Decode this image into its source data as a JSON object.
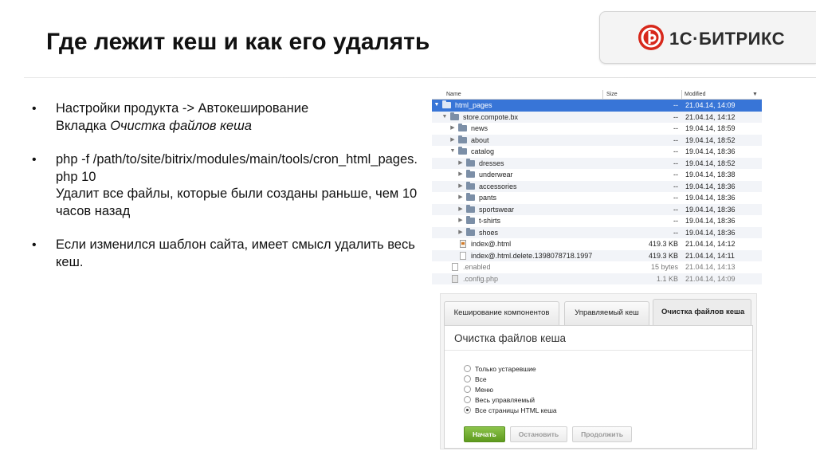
{
  "slide": {
    "title": "Где лежит кеш и как его удалять"
  },
  "logo": {
    "text": "1С·БИТРИКС",
    "mark_color": "#d7281b"
  },
  "bullets": [
    {
      "line1": "Настройки продукта -> Автокеширование",
      "line2_prefix": "Вкладка ",
      "line2_em": "Очистка файлов кеша"
    },
    {
      "cmd": "php -f /path/to/site/bitrix/modules/main/tools/cron_html_pages.php 10",
      "desc": "Удалит все файлы, которые были созданы раньше, чем 10 часов назад"
    },
    {
      "text": "Если изменился шаблон сайта, имеет смысл удалить весь кеш."
    }
  ],
  "file_browser": {
    "columns": {
      "name": "Name",
      "size": "Size",
      "modified": "Modified",
      "sort_indicator": "▼"
    },
    "rows": [
      {
        "name": "html_pages",
        "size": "--",
        "modified": "21.04.14, 14:09"
      },
      {
        "name": "store.compote.bx",
        "size": "--",
        "modified": "21.04.14, 14:12"
      },
      {
        "name": "news",
        "size": "--",
        "modified": "19.04.14, 18:59"
      },
      {
        "name": "about",
        "size": "--",
        "modified": "19.04.14, 18:52"
      },
      {
        "name": "catalog",
        "size": "--",
        "modified": "19.04.14, 18:36"
      },
      {
        "name": "dresses",
        "size": "--",
        "modified": "19.04.14, 18:52"
      },
      {
        "name": "underwear",
        "size": "--",
        "modified": "19.04.14, 18:38"
      },
      {
        "name": "accessories",
        "size": "--",
        "modified": "19.04.14, 18:36"
      },
      {
        "name": "pants",
        "size": "--",
        "modified": "19.04.14, 18:36"
      },
      {
        "name": "sportswear",
        "size": "--",
        "modified": "19.04.14, 18:36"
      },
      {
        "name": "t-shirts",
        "size": "--",
        "modified": "19.04.14, 18:36"
      },
      {
        "name": "shoes",
        "size": "--",
        "modified": "19.04.14, 18:36"
      },
      {
        "name": "index@.html",
        "size": "419.3 KB",
        "modified": "21.04.14, 14:12"
      },
      {
        "name": "index@.html.delete.1398078718.1997",
        "size": "419.3 KB",
        "modified": "21.04.14, 14:11"
      },
      {
        "name": ".enabled",
        "size": "15 bytes",
        "modified": "21.04.14, 14:13"
      },
      {
        "name": ".config.php",
        "size": "1.1 KB",
        "modified": "21.04.14, 14:09"
      }
    ]
  },
  "cache_panel": {
    "tabs": [
      "Кеширование компонентов",
      "Управляемый кеш",
      "Очистка файлов кеша"
    ],
    "section_title": "Очистка файлов кеша",
    "options": [
      "Только устаревшие",
      "Все",
      "Меню",
      "Весь управляемый",
      "Все страницы HTML кеша"
    ],
    "selected_option": "Все страницы HTML кеша",
    "buttons": {
      "start": "Начать",
      "stop": "Остановить",
      "continue": "Продолжить"
    }
  }
}
